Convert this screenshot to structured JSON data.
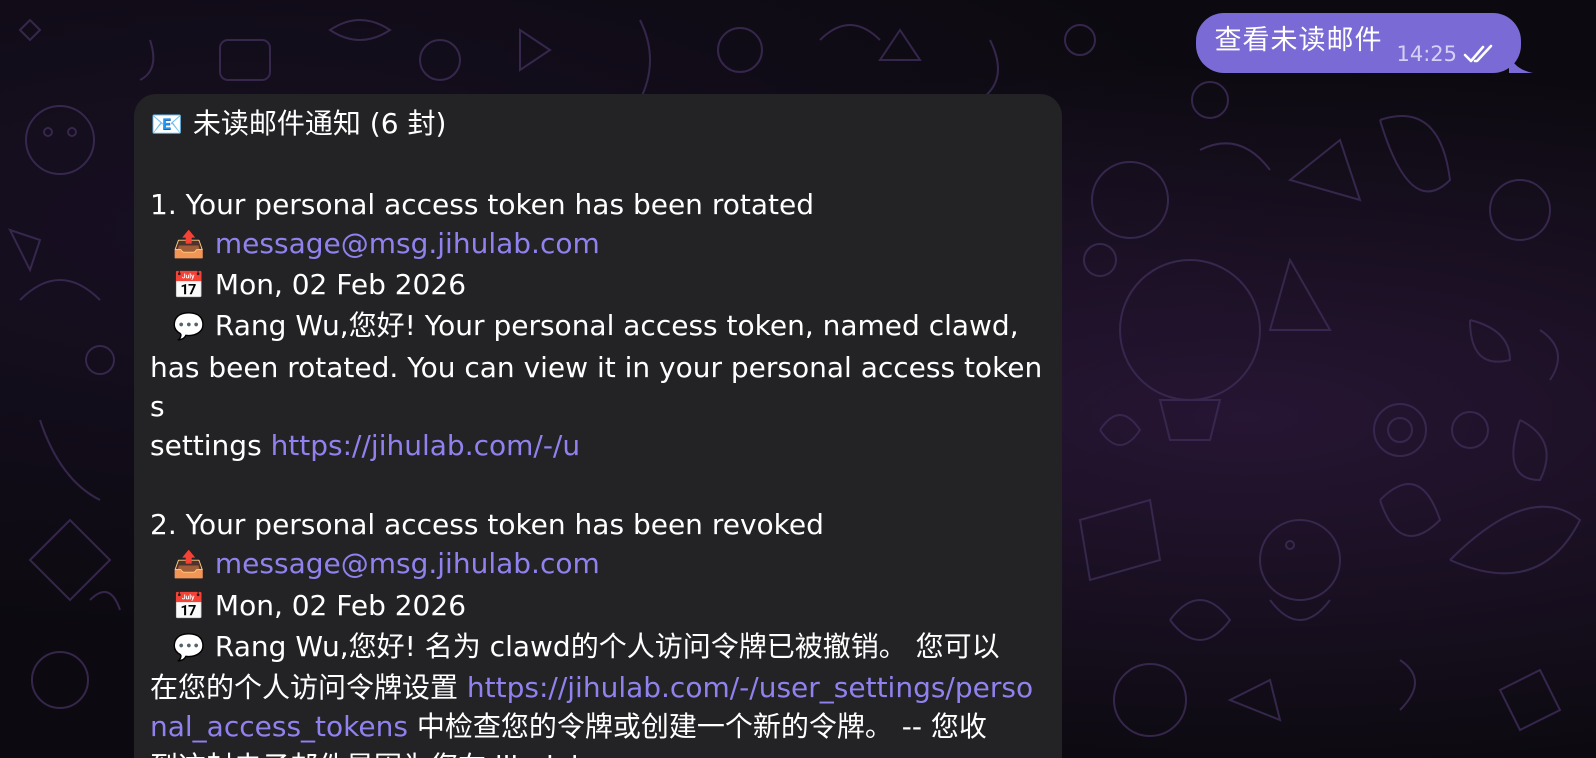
{
  "outgoing": {
    "text": "查看未读邮件",
    "time": "14:25",
    "status_icon": "double-check-icon",
    "bubble_color": "#7a6ad6"
  },
  "incoming": {
    "bubble_color": "#232225",
    "link_color": "#8f82ee",
    "header_icon": "📧",
    "header": "未读邮件通知 (6 封)",
    "emails": [
      {
        "title": "1. Your personal access token has been rotated",
        "sender_icon": "📤",
        "sender": "message@msg.jihulab.com",
        "date_icon": "📅",
        "date": "Mon, 02 Feb 2026",
        "preview_icon": "💬",
        "preview_l1": "Rang Wu,您好! Your personal access token, named clawd,",
        "preview_l2": "has been rotated. You can view it in your personal access tokens",
        "preview_l3_text": "settings ",
        "preview_l3_link": "https://jihulab.com/-/u"
      },
      {
        "title": "2. Your personal access token has been revoked",
        "sender_icon": "📤",
        "sender": "message@msg.jihulab.com",
        "date_icon": "📅",
        "date": "Mon, 02 Feb 2026",
        "preview_icon": "💬",
        "preview_l1": "Rang Wu,您好! 名为 clawd的个人访问令牌已被撤销。 您可以",
        "preview_l2_text": "在您的个人访问令牌设置 ",
        "preview_l2_link": "https://jihulab.com/-/user_settings/perso",
        "preview_l3_link": "nal_access_tokens",
        "preview_l3_text": " 中检查您的令牌或创建一个新的令牌。 -- 您收",
        "preview_l4": "到这封电子邮件是因为您在 jihulab"
      }
    ]
  }
}
